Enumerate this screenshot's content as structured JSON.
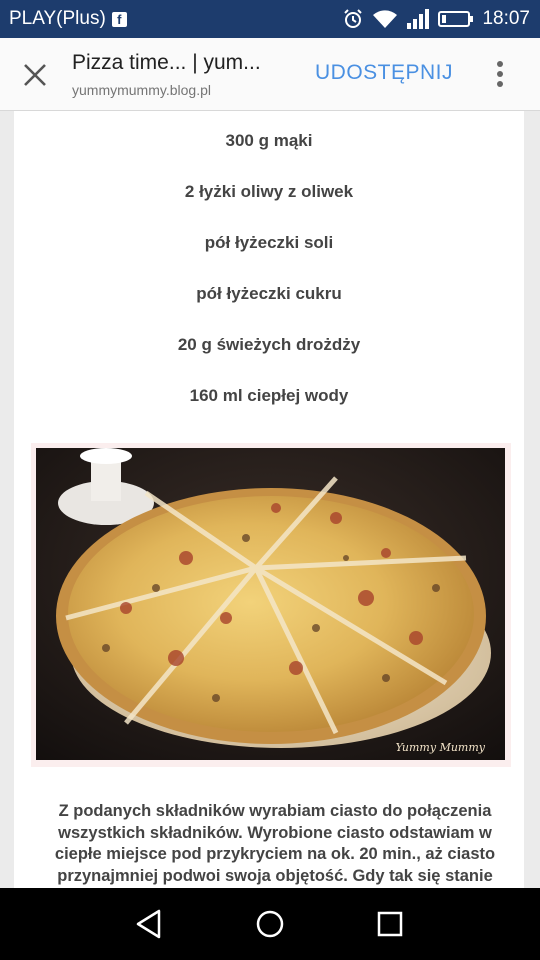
{
  "status_bar": {
    "carrier": "PLAY(Plus)",
    "fb_badge": "f",
    "time": "18:07",
    "icons": [
      "facebook-icon",
      "alarm-icon",
      "wifi-icon",
      "signal-icon",
      "battery-icon"
    ]
  },
  "header": {
    "title": "Pizza time... | yum...",
    "url": "yummymummy.blog.pl",
    "share_label": "UDOSTĘPNIJ",
    "icons": [
      "close-icon",
      "more-vert-icon"
    ]
  },
  "article": {
    "ingredients": [
      "300 g mąki",
      "2 łyżki oliwy z oliwek",
      "pół łyżeczki soli",
      "pół łyżeczki cukru",
      "20 g świeżych drożdży",
      "160 ml ciepłej wody"
    ],
    "image_alt": "pizza photo",
    "watermark": "Yummy Mummy",
    "paragraph": "Z podanych składników wyrabiam ciasto do połączenia wszystkich składników. Wyrobione ciasto odstawiam w ciepłe miejsce pod przykryciem na ok. 20 min., aż ciasto przynajmniej podwoi swoja objętość. Gdy tak się stanie"
  },
  "nav_bar": {
    "icons": [
      "back-icon",
      "home-icon",
      "recents-icon"
    ]
  },
  "colors": {
    "status_bar": "#1d3c6d",
    "accent": "#4a90e2",
    "text": "#444444"
  }
}
